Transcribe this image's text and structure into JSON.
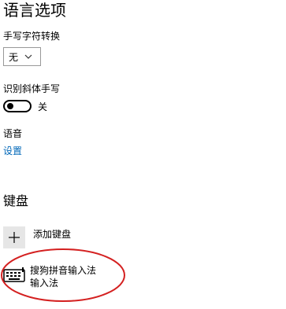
{
  "page": {
    "title": "语言选项"
  },
  "handwriting": {
    "conversion_label": "手写字符转换",
    "conversion_value": "无"
  },
  "italic": {
    "label": "识别斜体手写",
    "toggle_state": "关"
  },
  "speech": {
    "label": "语音",
    "settings_link": "设置"
  },
  "keyboard": {
    "section_title": "键盘",
    "add_label": "添加键盘",
    "items": [
      {
        "name": "搜狗拼音输入法",
        "subtitle": "输入法",
        "icon": "keyboard-icon"
      }
    ]
  },
  "annotation": {
    "color": "#d42020"
  },
  "colors": {
    "link": "#0067b8",
    "tile_bg": "#e6e6e6"
  }
}
